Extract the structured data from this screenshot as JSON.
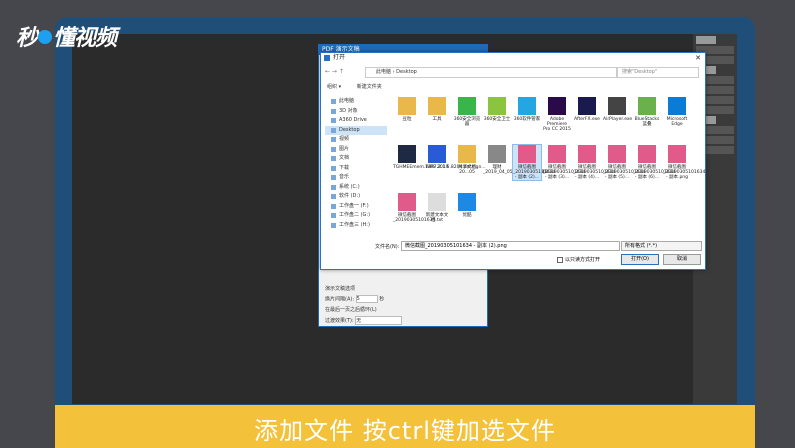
{
  "watermark": {
    "logo": "秒懂视频"
  },
  "caption": "添加文件 按ctrl键加选文件",
  "pdf_dialog": {
    "title": "PDF 演示文稿",
    "group_title": "演示文稿选项",
    "advance_label": "换片间隔(A):",
    "advance_value": "5",
    "advance_unit": "秒",
    "loop_label": "在最后一页之后循环(L)",
    "transition_label": "过渡效果(T):",
    "transition_value": "无"
  },
  "dialog": {
    "title": "打开",
    "nav": "← → ↑",
    "path": "此电脑 › Desktop",
    "search_placeholder": "搜索\"Desktop\"",
    "organize": "组织 ▾",
    "new_folder": "新建文件夹",
    "sidebar": [
      "此电脑",
      "3D 对象",
      "A360 Drive",
      "Desktop",
      "视频",
      "图片",
      "文档",
      "下载",
      "音乐",
      "系统 (C:)",
      "软件 (D:)",
      "工作盘一 (F:)",
      "工作盘二 (G:)",
      "工作盘三 (H:)"
    ],
    "files": [
      {
        "name": "豆粒",
        "color": "#e8b84a"
      },
      {
        "name": "工具",
        "color": "#e8b84a"
      },
      {
        "name": "360安全浏览器",
        "color": "#3ab54a"
      },
      {
        "name": "360安全卫士",
        "color": "#8bc53f"
      },
      {
        "name": "360软件管家",
        "color": "#26a6e1"
      },
      {
        "name": "Adobe Premiere Pro CC 2015",
        "color": "#2a0a49"
      },
      {
        "name": "AfterFX.exe",
        "color": "#1b1a4e"
      },
      {
        "name": "AirPlayer.exe",
        "color": "#444"
      },
      {
        "name": "BlueStacks 蓝叠",
        "color": "#6ab04c"
      },
      {
        "name": "Microsoft Edge",
        "color": "#0b7bd4"
      },
      {
        "name": "TGHMEEmem.1387.2.1.5.8204.dxf.sign...",
        "color": "#1e2a44"
      },
      {
        "name": "WPS 2019",
        "color": "#2a5bd7"
      },
      {
        "name": "共享文档20...05",
        "color": "#e8b84a"
      },
      {
        "name": "理财_2019_04_05_10_32_20_781...",
        "color": "#888"
      },
      {
        "name": "微信截图_20190305101634 - 副本 (2)...",
        "color": "#e05a8a",
        "sel": true
      },
      {
        "name": "微信截图_20190305101634 - 副本 (3)...",
        "color": "#e05a8a"
      },
      {
        "name": "微信截图_20190305101634 - 副本 (4)...",
        "color": "#e05a8a"
      },
      {
        "name": "微信截图_20190305101634 - 副本 (5)...",
        "color": "#e05a8a"
      },
      {
        "name": "微信截图_20190305101634 - 副本 (6)...",
        "color": "#e05a8a"
      },
      {
        "name": "微信截图_20190305101634 - 副本.png",
        "color": "#e05a8a"
      },
      {
        "name": "微信截图_20190305101634",
        "color": "#e05a8a"
      },
      {
        "name": "新建文本文档.txt",
        "color": "#ddd"
      },
      {
        "name": "优酷",
        "color": "#1e88e5"
      }
    ],
    "filename_label": "文件名(N):",
    "filename_value": "微信截图_20190305101634 - 副本 (2).png",
    "filetype": "所有格式 (*.*)",
    "readonly": "以只读方式打开",
    "open_btn": "打开(O)",
    "cancel_btn": "取消"
  }
}
